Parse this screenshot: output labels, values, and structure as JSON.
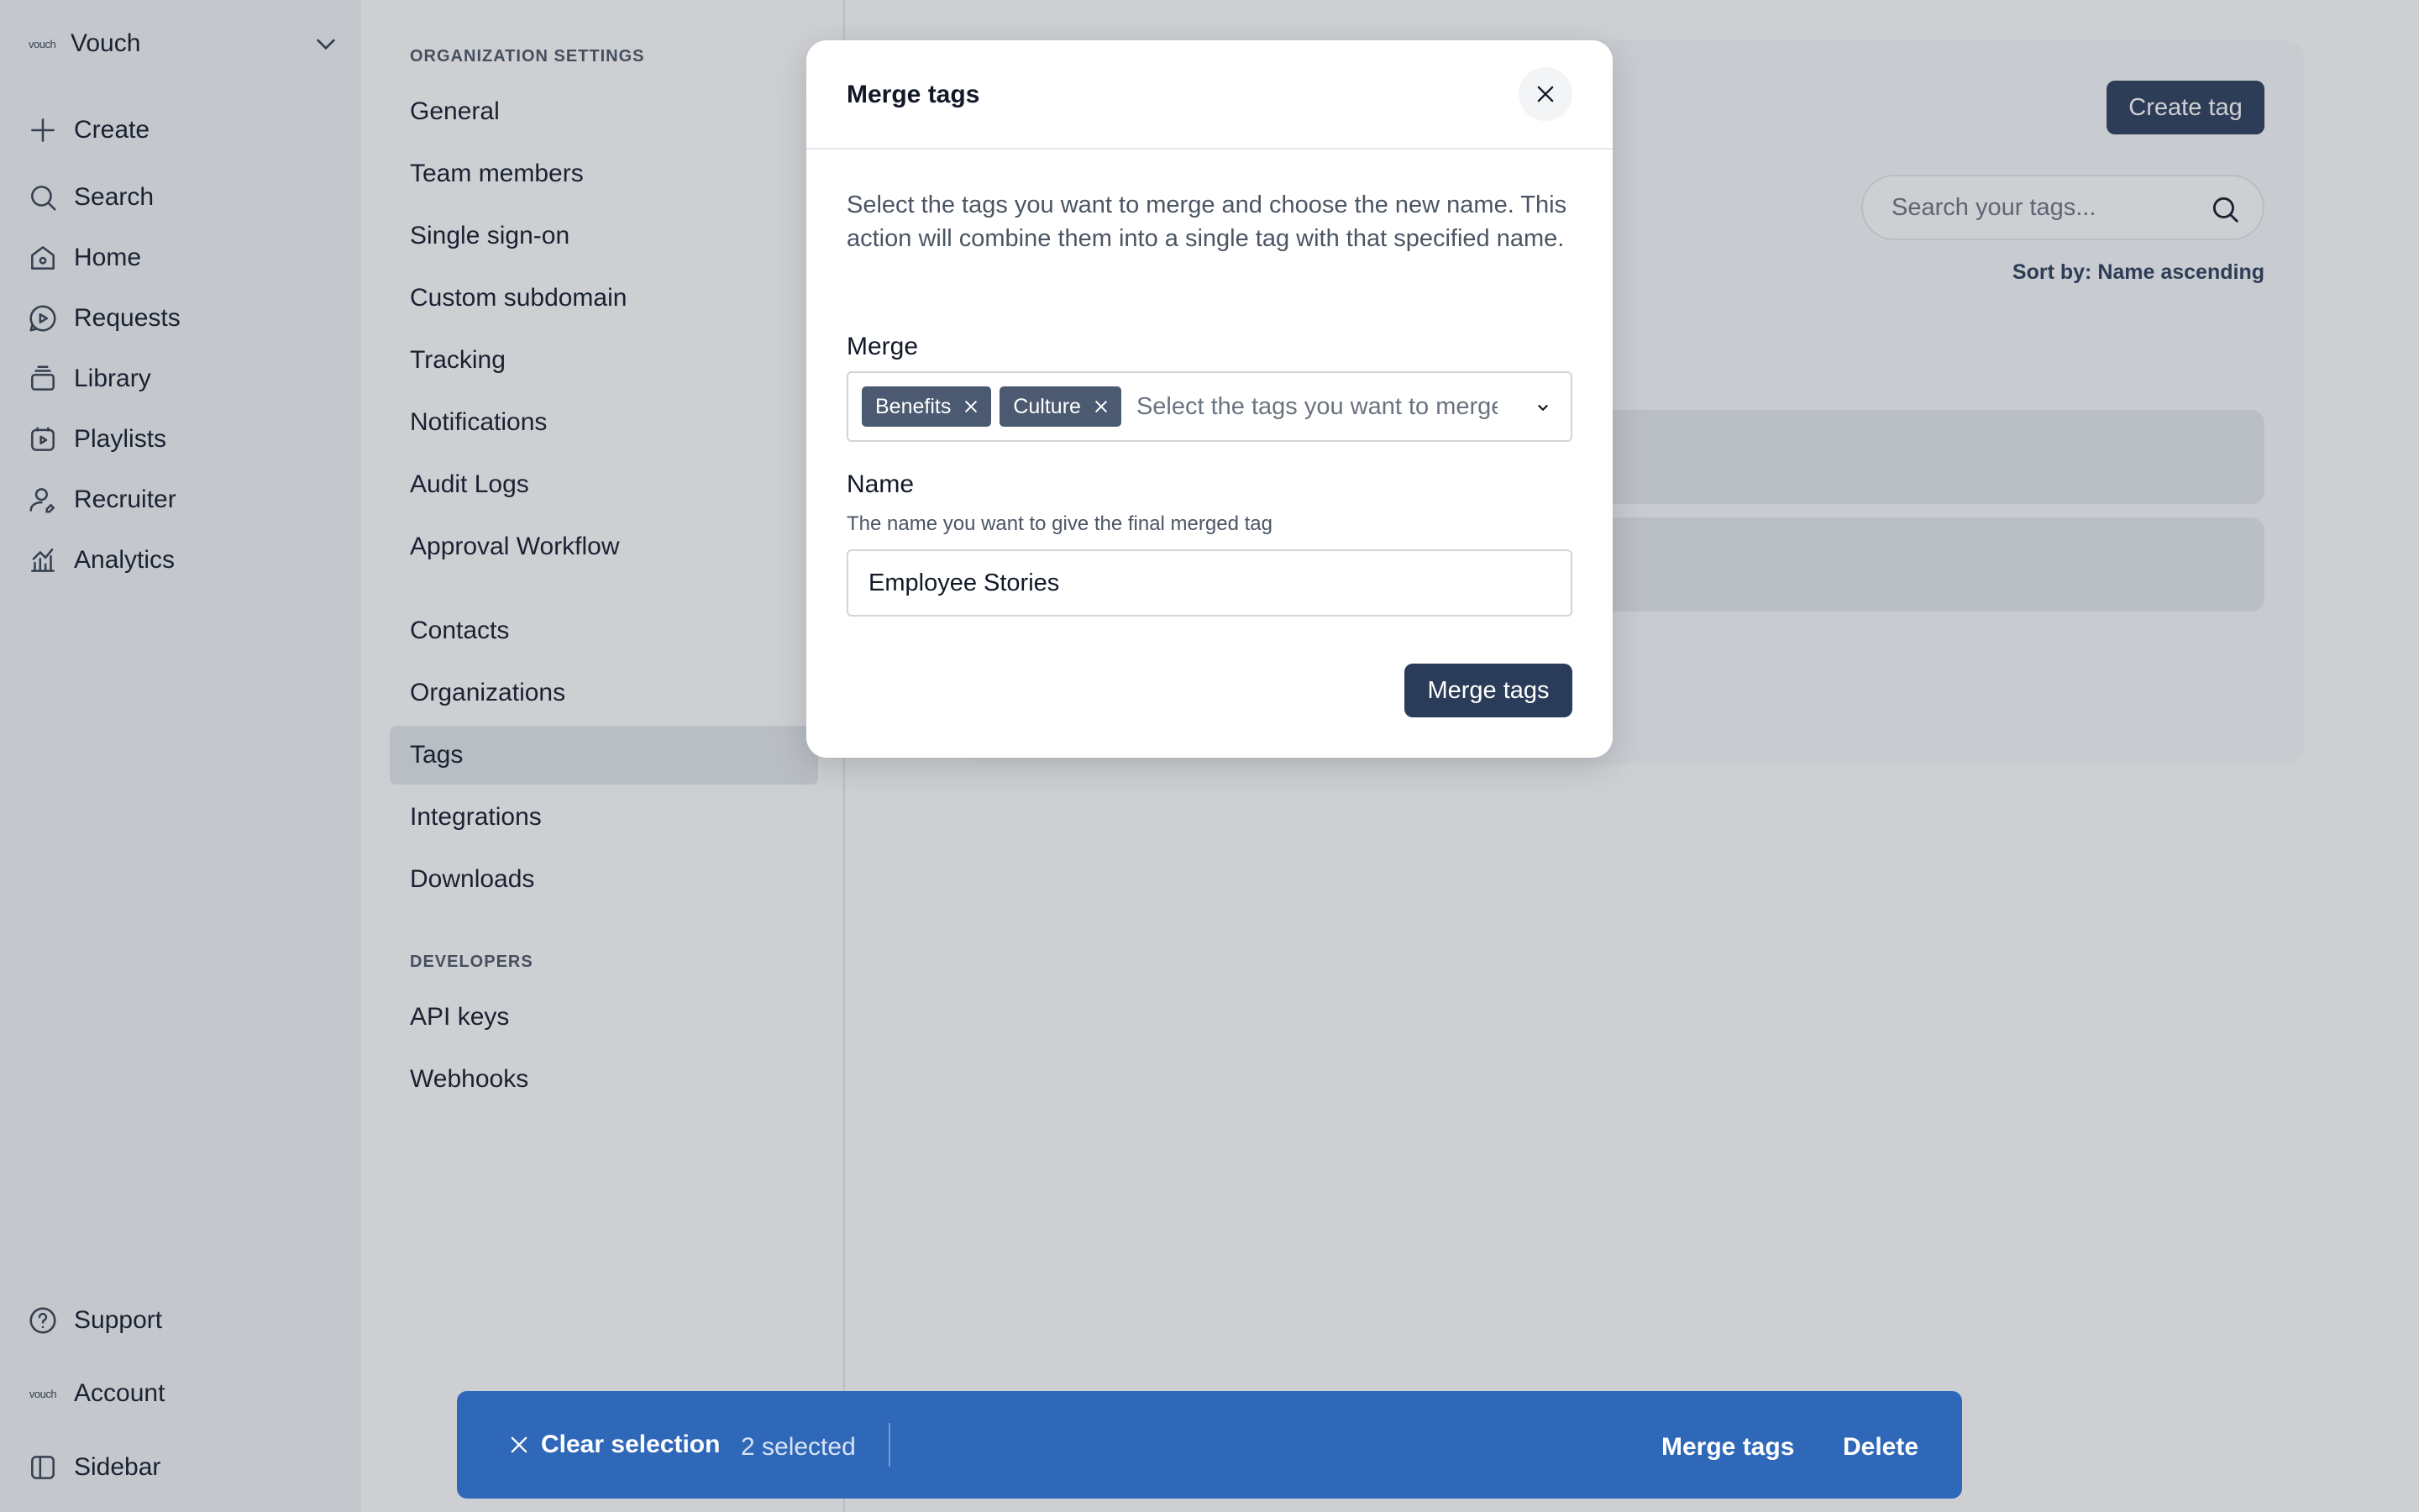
{
  "org": {
    "logo_text": "vouch",
    "name": "Vouch"
  },
  "app_nav": [
    {
      "label": "Create",
      "icon": "plus-icon"
    },
    {
      "label": "Search",
      "icon": "search-icon"
    },
    {
      "label": "Home",
      "icon": "home-icon"
    },
    {
      "label": "Requests",
      "icon": "requests-icon"
    },
    {
      "label": "Library",
      "icon": "library-icon"
    },
    {
      "label": "Playlists",
      "icon": "playlists-icon"
    },
    {
      "label": "Recruiter",
      "icon": "recruiter-icon"
    },
    {
      "label": "Analytics",
      "icon": "analytics-icon"
    }
  ],
  "app_nav_bottom": {
    "support": "Support",
    "account": "Account",
    "account_logo": "vouch",
    "sidebar": "Sidebar"
  },
  "settings": {
    "section_org": "ORGANIZATION SETTINGS",
    "org_items": [
      "General",
      "Team members",
      "Single sign-on",
      "Custom subdomain",
      "Tracking",
      "Notifications",
      "Audit Logs",
      "Approval Workflow"
    ],
    "other_items": [
      "Contacts",
      "Organizations",
      "Tags",
      "Integrations",
      "Downloads"
    ],
    "active_item": "Tags",
    "section_dev": "DEVELOPERS",
    "dev_items": [
      "API keys",
      "Webhooks"
    ]
  },
  "tags_page": {
    "create_button": "Create tag",
    "search_placeholder": "Search your tags...",
    "sort_label": "Sort by: Name ascending"
  },
  "modal": {
    "title": "Merge tags",
    "description": "Select the tags you want to merge and choose the new name. This action will combine them into a single tag with that specified name.",
    "merge_label": "Merge",
    "selected_tags": [
      "Benefits",
      "Culture"
    ],
    "merge_placeholder": "Select the tags you want to merge",
    "name_label": "Name",
    "name_hint": "The name you want to give the final merged tag",
    "name_value": "Employee Stories",
    "submit_label": "Merge tags"
  },
  "bulk_bar": {
    "clear_label": "Clear selection",
    "selected_count": "2 selected",
    "merge_label": "Merge tags",
    "delete_label": "Delete"
  },
  "colors": {
    "primary_dark": "#2b3c5a",
    "bulk_bar_blue": "#2f68b8",
    "chip_gray": "#4b5a71"
  }
}
